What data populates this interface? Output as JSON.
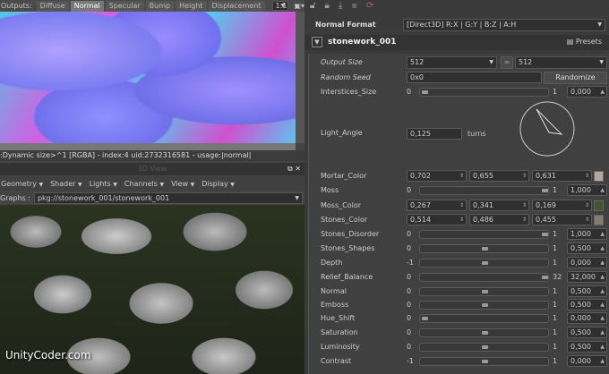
{
  "outputs": {
    "label": "Outputs:",
    "tabs": [
      "Diffuse",
      "Normal",
      "Specular",
      "Bump",
      "Height",
      "Displacement"
    ],
    "active": 1,
    "zoom": "1:1"
  },
  "status": ":Dynamic size>^1 [RGBA] - index:4 uid:2732316581 - usage:|normal|",
  "view3d": {
    "title": "3D View",
    "menu": [
      "Geometry",
      "Shader",
      "Lights",
      "Channels",
      "View",
      "Display"
    ],
    "graphs_label": "Graphs :",
    "graphs_value": "pkg://stonework_001/stonework_001"
  },
  "watermark": "UnityCoder.com",
  "normal_format": {
    "label": "Normal Format",
    "value": "[Direct3D] R:X | G:Y | B:Z | A:H"
  },
  "graph": {
    "title": "stonework_001",
    "presets": "Presets"
  },
  "output_size": {
    "label": "Output Size",
    "w": "512",
    "h": "512"
  },
  "random_seed": {
    "label": "Random Seed",
    "value": "0x0",
    "button": "Randomize"
  },
  "light_angle": {
    "label": "Light_Angle",
    "value": "0,125",
    "unit": "turns",
    "turns": 0.125
  },
  "sliders": [
    {
      "label": "Interstices_Size",
      "min": "0",
      "max": "1",
      "value": "0,000",
      "fraction": 0
    },
    {
      "label": "Moss",
      "min": "0",
      "max": "1",
      "value": "1,000",
      "fraction": 1
    },
    {
      "label": "Stones_Disorder",
      "min": "0",
      "max": "1",
      "value": "1,000",
      "fraction": 1
    },
    {
      "label": "Stones_Shapes",
      "min": "0",
      "max": "1",
      "value": "0,500",
      "fraction": 0.5
    },
    {
      "label": "Depth",
      "min": "-1",
      "max": "1",
      "value": "0,000",
      "fraction": 0.5
    },
    {
      "label": "Relief_Balance",
      "min": "0",
      "max": "32",
      "value": "32,000",
      "fraction": 1
    },
    {
      "label": "Normal",
      "min": "0",
      "max": "1",
      "value": "0,500",
      "fraction": 0.5
    },
    {
      "label": "Emboss",
      "min": "0",
      "max": "1",
      "value": "0,500",
      "fraction": 0.5
    },
    {
      "label": "Hue_Shift",
      "min": "0",
      "max": "1",
      "value": "0,000",
      "fraction": 0
    },
    {
      "label": "Saturation",
      "min": "0",
      "max": "1",
      "value": "0,500",
      "fraction": 0.5
    },
    {
      "label": "Luminosity",
      "min": "0",
      "max": "1",
      "value": "0,500",
      "fraction": 0.5
    },
    {
      "label": "Contrast",
      "min": "-1",
      "max": "1",
      "value": "0,000",
      "fraction": 0.5
    }
  ],
  "colors": [
    {
      "label": "Mortar_Color",
      "r": "0,702",
      "g": "0,655",
      "b": "0,631",
      "swatch": "#b3a7a1"
    },
    {
      "label": "Moss_Color",
      "r": "0,267",
      "g": "0,341",
      "b": "0,169",
      "swatch": "#44572b"
    },
    {
      "label": "Stones_Color",
      "r": "0,514",
      "g": "0,486",
      "b": "0,455",
      "swatch": "#837c74"
    }
  ]
}
